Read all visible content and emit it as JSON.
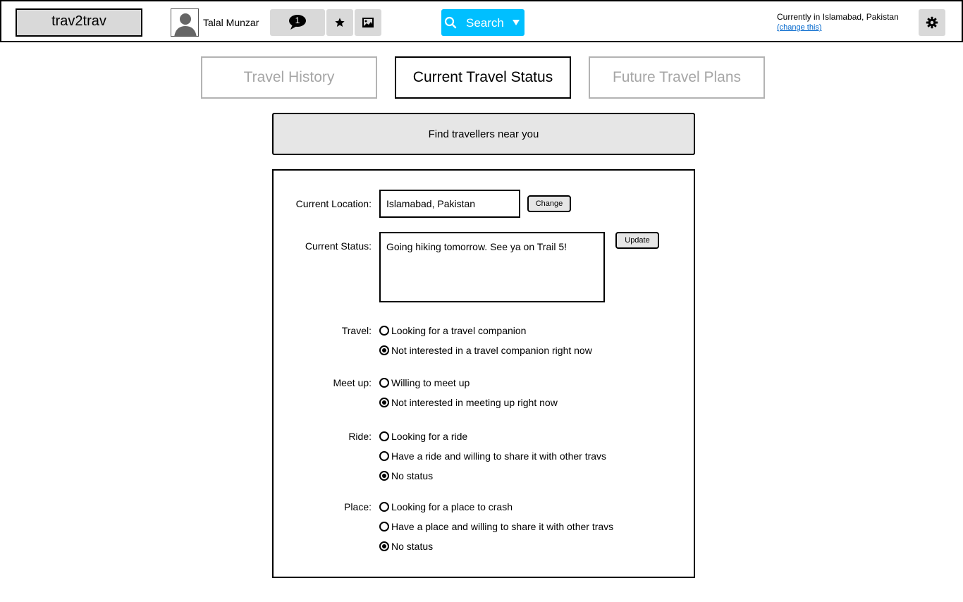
{
  "header": {
    "logo": "trav2trav",
    "user_name": "Talal Munzar",
    "messages_count": "1",
    "search_label": "Search",
    "location_text": "Currently in Islamabad, Pakistan",
    "change_location_link": "(change this)"
  },
  "tabs": [
    {
      "label": "Travel History",
      "active": false
    },
    {
      "label": "Current Travel Status",
      "active": true
    },
    {
      "label": "Future Travel Plans",
      "active": false
    }
  ],
  "find_bar": "Find travellers near you",
  "form": {
    "location_label": "Current Location:",
    "location_value": "Islamabad, Pakistan",
    "change_button": "Change",
    "status_label": "Current Status:",
    "status_value": "Going hiking tomorrow. See ya on Trail 5!",
    "update_button": "Update",
    "groups": [
      {
        "label": "Travel:",
        "options": [
          "Looking for a travel companion",
          "Not interested in a travel companion right now"
        ],
        "selected": 1
      },
      {
        "label": "Meet up:",
        "options": [
          "Willing to meet up",
          "Not interested in meeting up right now"
        ],
        "selected": 1
      },
      {
        "label": "Ride:",
        "options": [
          "Looking for a ride",
          "Have a ride and willing to share it with other travs",
          "No status"
        ],
        "selected": 2
      },
      {
        "label": "Place:",
        "options": [
          "Looking for a place to crash",
          "Have a place and willing to share it with other travs",
          "No status"
        ],
        "selected": 2
      }
    ]
  },
  "colors": {
    "search_accent": "#00bfff",
    "link": "#0066cc",
    "button_gray": "#d9d9d9",
    "inactive_tab_text": "#a6a6a6"
  }
}
